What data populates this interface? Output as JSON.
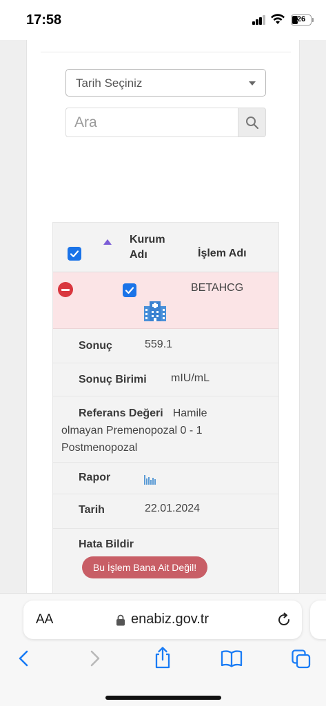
{
  "status_bar": {
    "time": "17:58",
    "battery": "26"
  },
  "filters": {
    "date_select_label": "Tarih Seçiniz",
    "search_placeholder": "Ara"
  },
  "table": {
    "headers": {
      "kurum_line1": "Kurum",
      "kurum_line2": "Adı",
      "islem": "İşlem Adı"
    },
    "row": {
      "islem_adi": "BETAHCG",
      "details": {
        "sonuc_label": "Sonuç",
        "sonuc_value": "559.1",
        "birim_label": "Sonuç Birimi",
        "birim_value": "mIU/mL",
        "referans_label": "Referans Değeri",
        "referans_value_1": "Hamile",
        "referans_value_2": "olmayan Premenopozal 0 - 1",
        "referans_value_3": "Postmenopozal",
        "rapor_label": "Rapor",
        "tarih_label": "Tarih",
        "tarih_value": "22.01.2024",
        "hata_label": "Hata Bildir",
        "hata_button": "Bu İşlem Bana Ait Değil!"
      }
    }
  },
  "browser": {
    "aa_label": "AA",
    "domain": "enabiz.gov.tr"
  },
  "colors": {
    "accent_blue": "#1a73e8",
    "row_highlight": "#fbe4e6",
    "danger": "#d9363e",
    "error_button": "#c85e66",
    "ios_blue": "#1a7cf5"
  }
}
